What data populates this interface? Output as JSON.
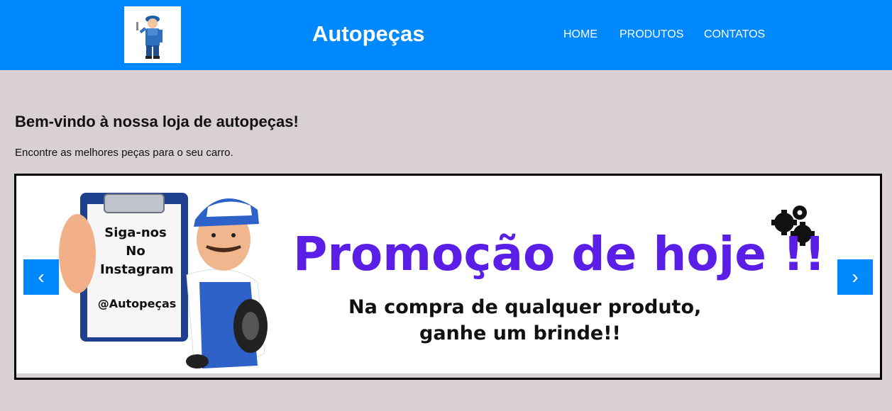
{
  "header": {
    "title": "Autopeças",
    "nav": [
      {
        "label": "HOME"
      },
      {
        "label": "PRODUTOS"
      },
      {
        "label": "CONTATOS"
      }
    ]
  },
  "main": {
    "welcome": "Bem-vindo à nossa loja de autopeças!",
    "subtitle": "Encontre as melhores peças para o seu carro."
  },
  "carousel": {
    "prev_label": "‹",
    "next_label": "›",
    "slide": {
      "clipboard_lines": [
        "Siga-nos",
        "No",
        "Instagram"
      ],
      "handle": "@Autopeças",
      "promo_title": "Promoção de hoje !!",
      "promo_line1": "Na compra de qualquer produto,",
      "promo_line2": "ganhe um brinde!!"
    }
  },
  "colors": {
    "header_bg": "#0088ff",
    "page_bg": "#d8d0d2",
    "promo_purple": "#5a1ee6"
  }
}
